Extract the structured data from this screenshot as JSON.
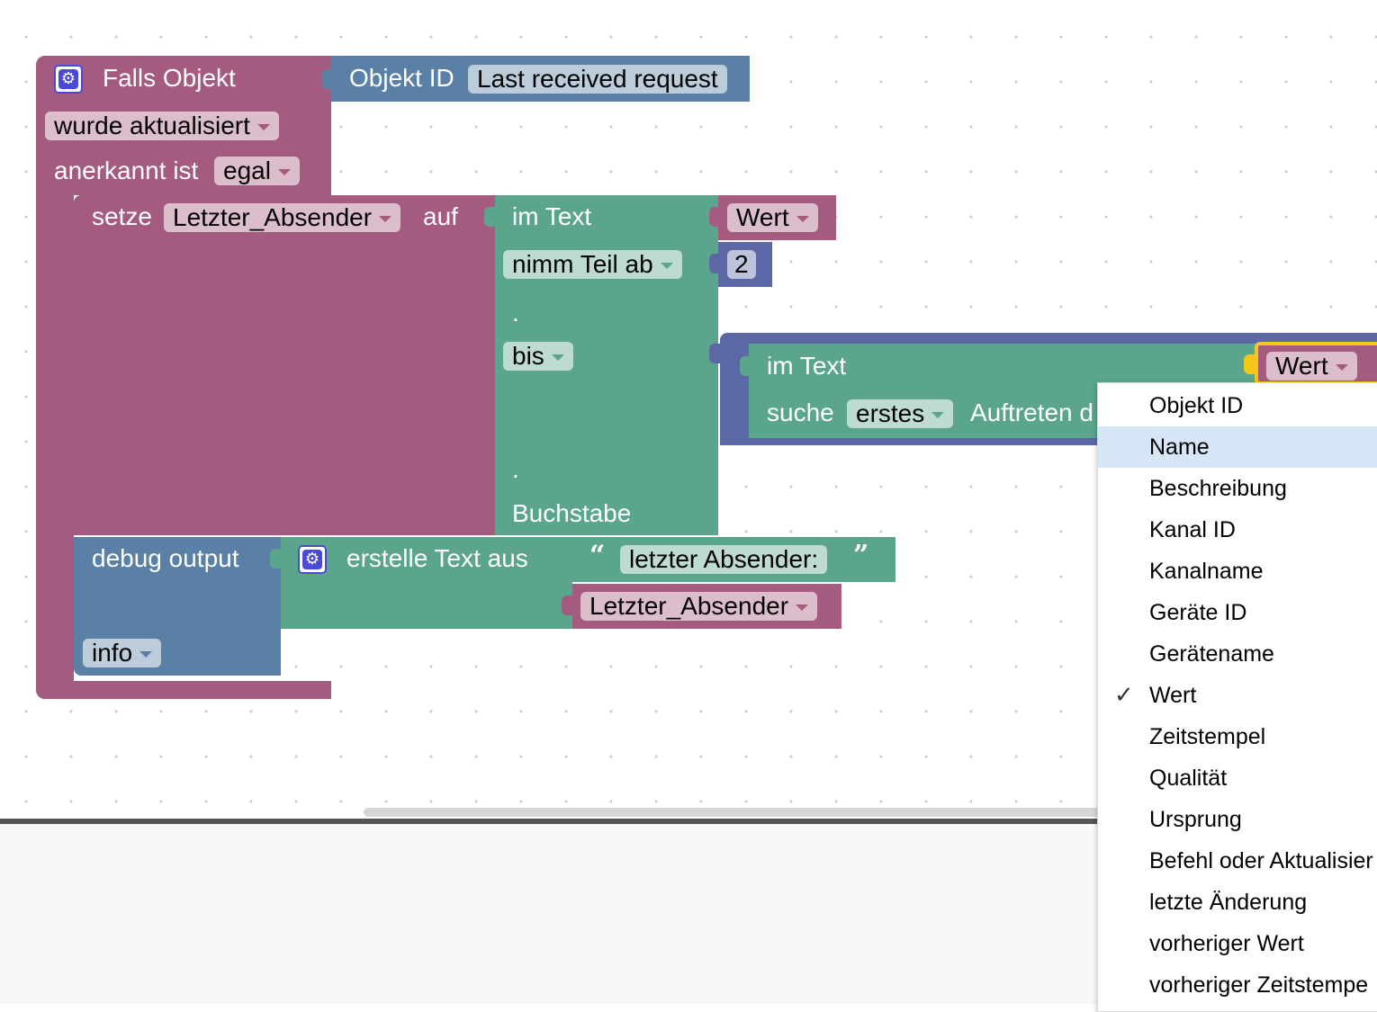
{
  "event_block": {
    "title": "Falls Objekt",
    "trigger_value": "wurde aktualisiert",
    "ack_label": "anerkannt ist",
    "ack_value": "egal"
  },
  "object_id_block": {
    "label": "Objekt ID",
    "value": "Last received request"
  },
  "set_block": {
    "label_set": "setze",
    "variable": "Letzter_Absender",
    "label_to": "auf"
  },
  "substring_block": {
    "label_in_text": "im Text",
    "mode": "nimm Teil ab",
    "dot1": ".",
    "to_mode": "bis",
    "dot2": ".",
    "suffix": "Buchstabe"
  },
  "wert_block_1": {
    "value": "Wert"
  },
  "number_block": {
    "value": "2"
  },
  "indexof_block": {
    "label_in_text": "im Text",
    "label_find": "suche",
    "which": "erstes",
    "label_occurrence": "Auftreten d",
    "attr_value": "Wert"
  },
  "debug_block": {
    "label": "debug output",
    "level": "info"
  },
  "join_block": {
    "label": "erstelle Text aus",
    "text_value": "letzter Absender:",
    "open_quote": "“",
    "close_quote": "”",
    "variable": "Letzter_Absender"
  },
  "dropdown_menu": {
    "selected": "Wert",
    "highlighted": "Name",
    "check_glyph": "✓",
    "items": [
      "Objekt ID",
      "Name",
      "Beschreibung",
      "Kanal ID",
      "Kanalname",
      "Geräte ID",
      "Gerätename",
      "Wert",
      "Zeitstempel",
      "Qualität",
      "Ursprung",
      "Befehl oder Aktualisier",
      "letzte Änderung",
      "vorheriger Wert",
      "vorheriger Zeitstempe"
    ]
  },
  "colors": {
    "event": "#a55b80",
    "text": "#5ba58c",
    "object": "#5b80a5",
    "math": "#5c68a6"
  }
}
